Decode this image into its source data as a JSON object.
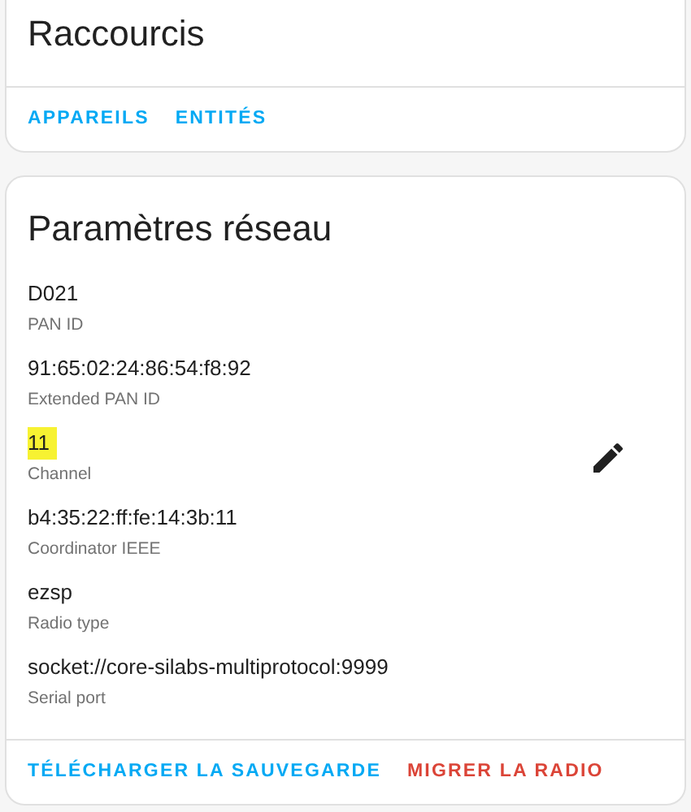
{
  "shortcuts_card": {
    "title": "Raccourcis",
    "actions": [
      {
        "label": "APPAREILS",
        "kind": "primary"
      },
      {
        "label": "ENTITÉS",
        "kind": "primary"
      }
    ]
  },
  "network_card": {
    "title": "Paramètres réseau",
    "settings": [
      {
        "value": "D021",
        "label": "PAN ID",
        "highlighted": false,
        "editable": false
      },
      {
        "value": "91:65:02:24:86:54:f8:92",
        "label": "Extended PAN ID",
        "highlighted": false,
        "editable": false
      },
      {
        "value": "11",
        "label": "Channel",
        "highlighted": true,
        "editable": true
      },
      {
        "value": "b4:35:22:ff:fe:14:3b:11",
        "label": "Coordinator IEEE",
        "highlighted": false,
        "editable": false
      },
      {
        "value": "ezsp",
        "label": "Radio type",
        "highlighted": false,
        "editable": false
      },
      {
        "value": "socket://core-silabs-multiprotocol:9999",
        "label": "Serial port",
        "highlighted": false,
        "editable": false
      }
    ],
    "actions": [
      {
        "label": "TÉLÉCHARGER LA SAUVEGARDE",
        "kind": "primary"
      },
      {
        "label": "MIGRER LA RADIO",
        "kind": "warning"
      }
    ]
  }
}
